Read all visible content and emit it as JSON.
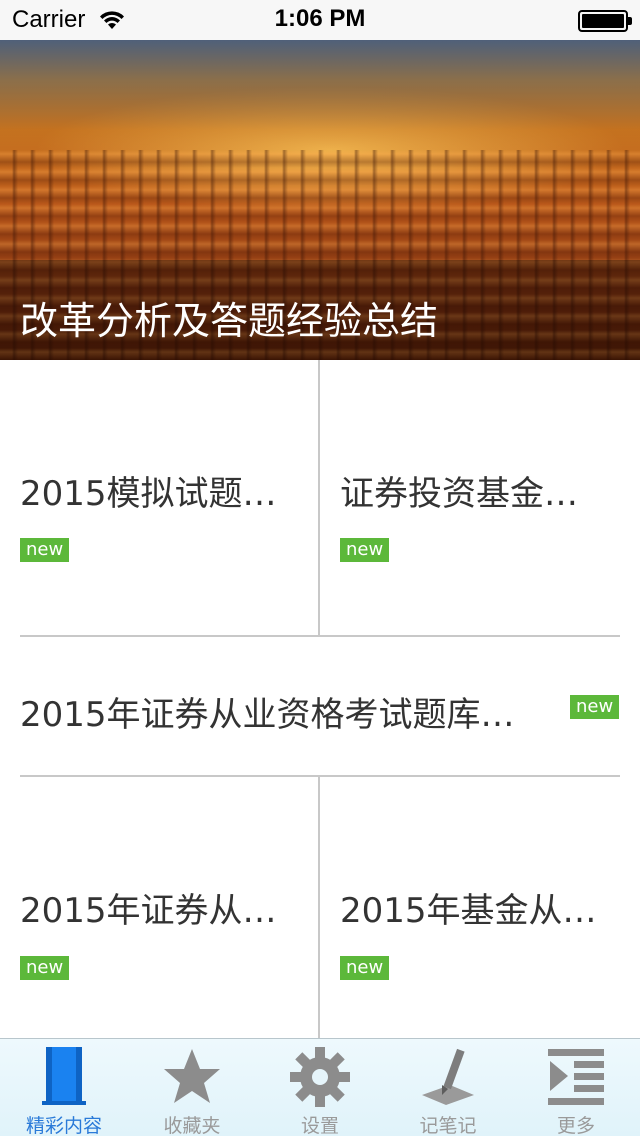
{
  "status_bar": {
    "carrier": "Carrier",
    "time": "1:06 PM"
  },
  "banner": {
    "caption": "改革分析及答题经验总结"
  },
  "grid": {
    "row1": [
      {
        "title": "2015模拟试题…",
        "badge": "new"
      },
      {
        "title": "证券投资基金…",
        "badge": "new"
      }
    ],
    "row2": {
      "title": "2015年证券从业资格考试题库…",
      "badge": "new"
    },
    "row3": [
      {
        "title": "2015年证券从…",
        "badge": "new"
      },
      {
        "title": "2015年基金从…",
        "badge": "new"
      }
    ]
  },
  "tab_bar": {
    "items": [
      {
        "label": "精彩内容",
        "icon": "book-icon",
        "active": true
      },
      {
        "label": "收藏夹",
        "icon": "star-icon",
        "active": false
      },
      {
        "label": "设置",
        "icon": "gear-icon",
        "active": false
      },
      {
        "label": "记笔记",
        "icon": "pen-icon",
        "active": false
      },
      {
        "label": "更多",
        "icon": "more-list-icon",
        "active": false
      }
    ]
  },
  "colors": {
    "badge_green": "#5cb83a",
    "tab_active": "#2a7ad8",
    "tab_inactive": "#9a9a9a"
  }
}
